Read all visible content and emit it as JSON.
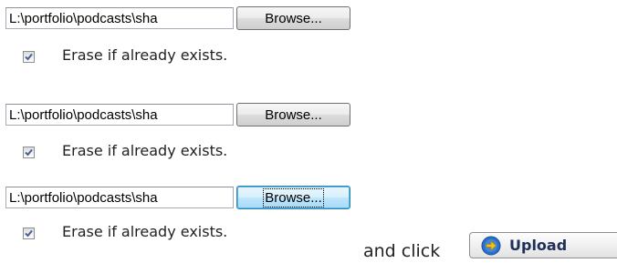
{
  "rows": [
    {
      "path_value": "L:\\portfolio\\podcasts\\sha",
      "browse_label": "Browse...",
      "checkbox_checked": true,
      "checkbox_label": "Erase if already exists."
    },
    {
      "path_value": "L:\\portfolio\\podcasts\\sha",
      "browse_label": "Browse...",
      "checkbox_checked": true,
      "checkbox_label": "Erase if already exists."
    },
    {
      "path_value": "L:\\portfolio\\podcasts\\sha",
      "browse_label": "Browse...",
      "browse_focused": true,
      "checkbox_checked": true,
      "checkbox_label": "Erase if already exists."
    }
  ],
  "instruction_text": "and click",
  "upload_button": {
    "label": "Upload",
    "icon": "upload-arrow-icon"
  },
  "colors": {
    "checkmark": "#4a5f97",
    "upload_icon_blue": "#2a6fc9",
    "upload_icon_yellow": "#f2c21a",
    "focus_border": "#3c7fb1"
  }
}
